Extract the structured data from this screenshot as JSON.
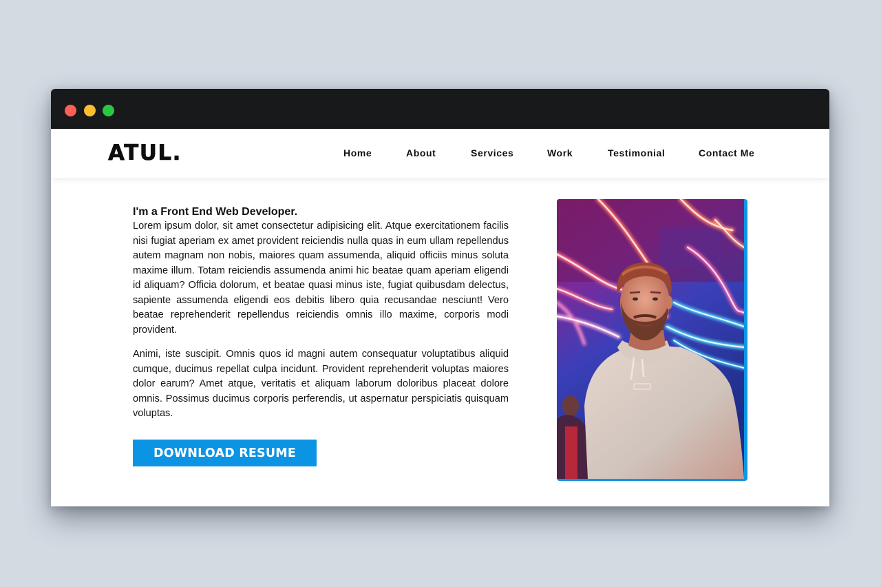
{
  "window": {
    "controls": [
      {
        "name": "close",
        "color": "#fe5f57"
      },
      {
        "name": "minimize",
        "color": "#febc2e"
      },
      {
        "name": "maximize",
        "color": "#28c840"
      }
    ]
  },
  "header": {
    "logo": "ATUL.",
    "nav": [
      {
        "label": "Home"
      },
      {
        "label": "About"
      },
      {
        "label": "Services"
      },
      {
        "label": "Work"
      },
      {
        "label": "Testimonial"
      },
      {
        "label": "Contact Me"
      }
    ]
  },
  "hero": {
    "headline": "I'm a Front End Web Developer.",
    "paragraphs": [
      "Lorem ipsum dolor, sit amet consectetur adipisicing elit. Atque exercitationem facilis nisi fugiat aperiam ex amet provident reiciendis nulla quas in eum ullam repellendus autem magnam non nobis, maiores quam assumenda, aliquid officiis minus soluta maxime illum. Totam reiciendis assumenda animi hic beatae quam aperiam eligendi id aliquam? Officia dolorum, et beatae quasi minus iste, fugiat quibusdam delectus, sapiente assumenda eligendi eos debitis libero quia recusandae nesciunt! Vero beatae reprehenderit repellendus reiciendis omnis illo maxime, corporis modi provident.",
      "Animi, iste suscipit. Omnis quos id magni autem consequatur voluptatibus aliquid cumque, ducimus repellat culpa incidunt. Provident reprehenderit voluptas maiores dolor earum? Amet atque, veritatis et aliquam laborum doloribus placeat dolore omnis. Possimus ducimus corporis perferendis, ut aspernatur perspiciatis quisquam voluptas."
    ],
    "download_label": "DOWNLOAD RESUME",
    "photo_alt": "Portrait of a bearded man in a light hoodie under neon lights",
    "accent_color": "#0a94e3"
  }
}
